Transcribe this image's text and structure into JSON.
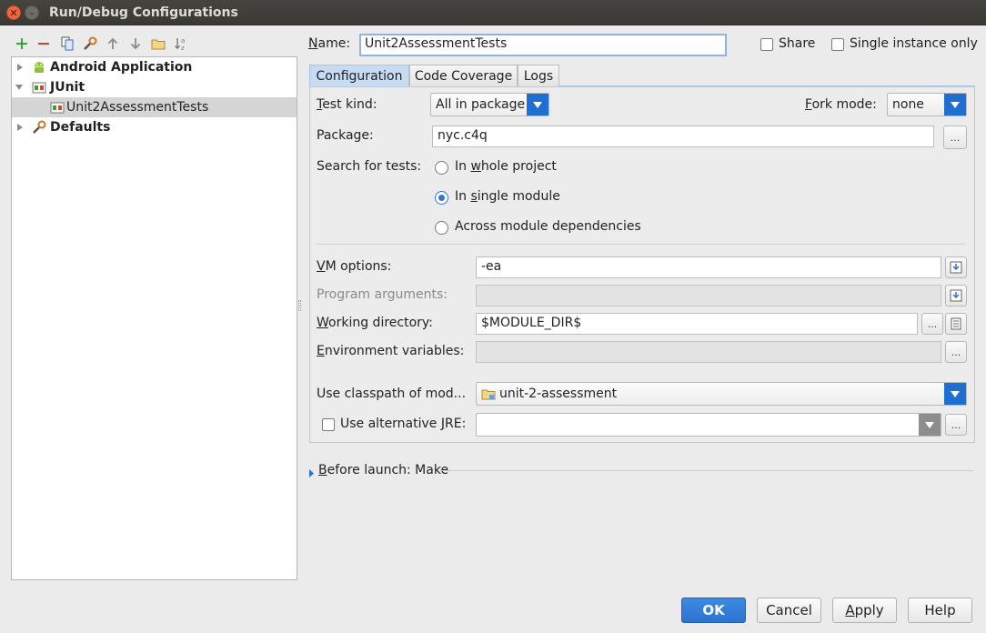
{
  "window": {
    "title": "Run/Debug Configurations"
  },
  "toolbar": {
    "icons": [
      "add-icon",
      "remove-icon",
      "copy-icon",
      "wrench-icon",
      "arrow-up-icon",
      "arrow-down-icon",
      "folder-icon",
      "sort-icon"
    ]
  },
  "tree": {
    "items": [
      {
        "label": "Android Application",
        "bold": true,
        "icon": "android-icon",
        "expanded": false
      },
      {
        "label": "JUnit",
        "bold": true,
        "icon": "junit-icon",
        "expanded": true
      },
      {
        "label": "Unit2AssessmentTests",
        "bold": false,
        "icon": "test-config-icon",
        "selected": true
      },
      {
        "label": "Defaults",
        "bold": true,
        "icon": "wrench-icon",
        "expanded": false
      }
    ]
  },
  "header": {
    "name_label": "Name:",
    "name_value": "Unit2AssessmentTests",
    "share_label": "Share",
    "single_instance_label": "Single instance only"
  },
  "tabs": [
    {
      "label": "Configuration",
      "active": true
    },
    {
      "label": "Code Coverage",
      "active": false
    },
    {
      "label": "Logs",
      "active": false
    }
  ],
  "config": {
    "test_kind_label": "Test kind:",
    "test_kind_value": "All in package",
    "fork_mode_label": "Fork mode:",
    "fork_mode_value": "none",
    "package_label": "Package:",
    "package_value": "nyc.c4q",
    "search_label": "Search for tests:",
    "search_options": [
      {
        "label": "In whole project",
        "selected": false
      },
      {
        "label": "In single module",
        "selected": true
      },
      {
        "label": "Across module dependencies",
        "selected": false
      }
    ],
    "vm_options_label": "VM options:",
    "vm_options_value": "-ea",
    "program_args_label": "Program arguments:",
    "program_args_value": "",
    "working_dir_label": "Working directory:",
    "working_dir_value": "$MODULE_DIR$",
    "env_vars_label": "Environment variables:",
    "env_vars_value": "",
    "classpath_label": "Use classpath of mod...",
    "classpath_value": "unit-2-assessment",
    "alt_jre_label": "Use alternative JRE:",
    "alt_jre_value": "",
    "ellipsis": "..."
  },
  "before_launch": {
    "label": "Before launch: Make"
  },
  "buttons": {
    "ok": "OK",
    "cancel": "Cancel",
    "apply": "Apply",
    "help": "Help"
  },
  "colors": {
    "accent": "#2c74d1",
    "selection": "#d5d5d5",
    "titlebar": "#3d3c38"
  }
}
